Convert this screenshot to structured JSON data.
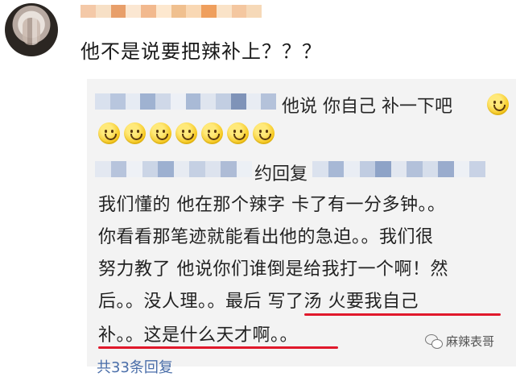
{
  "comment": {
    "text": "他不是说要把辣补上？？？"
  },
  "reply1": {
    "text": "他说 你自己 补一下吧"
  },
  "reply2": {
    "text": "约回复"
  },
  "body_lines": [
    "我们懂的 他在那个辣字 卡了有一分多钟。。",
    "你看看那笔迹就能看出他的急迫。。我们很",
    "努力教了 他说你们谁倒是给我打一个啊！然",
    "后。。没人理。。最后 写了汤 火要我自己",
    "补。。这是什么天才啊。。"
  ],
  "more_replies": "共33条回复",
  "watermark": "麻辣表哥",
  "icons": {
    "smiley": "smiley-icon",
    "wechat": "wechat-icon"
  },
  "colors": {
    "underline": "#e0182b",
    "reply_bg": "#f3f3f3",
    "link": "#4a6ea9"
  }
}
